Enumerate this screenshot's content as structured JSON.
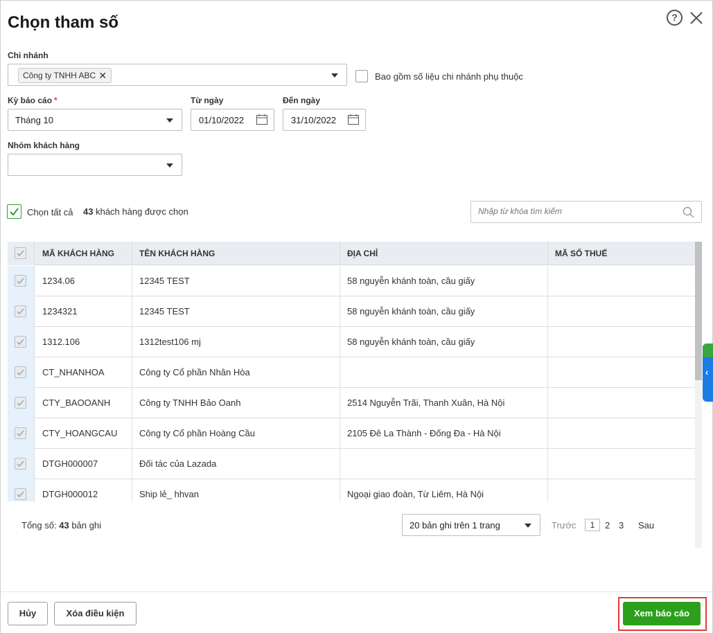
{
  "dialog": {
    "title": "Chọn tham số"
  },
  "branch": {
    "label": "Chi nhánh",
    "selected_chip": "Công ty TNHH ABC",
    "chip_remove": "✕",
    "include_dependent_label": "Bao gồm số liệu chi nhánh phụ thuộc"
  },
  "period": {
    "label": "Kỳ báo cáo",
    "required_mark": "*",
    "value": "Tháng 10"
  },
  "from_date": {
    "label": "Từ ngày",
    "value": "01/10/2022"
  },
  "to_date": {
    "label": "Đến ngày",
    "value": "31/10/2022"
  },
  "customer_group": {
    "label": "Nhóm khách hàng",
    "value": ""
  },
  "selection": {
    "select_all_label": "Chọn tất cả",
    "selected_count": "43",
    "selected_suffix": "khách hàng được chọn"
  },
  "search": {
    "placeholder": "Nhập từ khóa tìm kiếm"
  },
  "table": {
    "columns": [
      "MÃ KHÁCH HÀNG",
      "TÊN KHÁCH HÀNG",
      "ĐỊA CHỈ",
      "MÃ SỐ THUẾ"
    ],
    "rows": [
      [
        "1234.06",
        "12345 TEST",
        "58 nguyễn khánh toàn, cầu giấy",
        ""
      ],
      [
        "1234321",
        "12345 TEST",
        "58 nguyễn khánh toàn, cầu giấy",
        ""
      ],
      [
        "1312.106",
        "1312test106 mj",
        "58 nguyễn khánh toàn, cầu giấy",
        ""
      ],
      [
        "CT_NHANHOA",
        "Công ty Cổ phần Nhân Hòa",
        "",
        ""
      ],
      [
        "CTY_BAOOANH",
        "Công ty TNHH Bảo Oanh",
        "2514 Nguyễn Trãi, Thanh Xuân, Hà Nội",
        ""
      ],
      [
        "CTY_HOANGCAU",
        "Công ty Cổ phần Hoàng Cầu",
        "2105 Đê La Thành - Đống Đa - Hà Nội",
        ""
      ],
      [
        "DTGH000007",
        "Đối tác của Lazada",
        "",
        ""
      ],
      [
        "DTGH000012",
        "Ship lẻ_ hhvan",
        "Ngoại giao đoàn, Từ Liêm, Hà Nội",
        ""
      ]
    ]
  },
  "pager": {
    "total_prefix": "Tổng số:",
    "total_count": "43",
    "total_suffix": "bản ghi",
    "page_size": "20 bản ghi trên 1 trang",
    "prev": "Trước",
    "pages": [
      "1",
      "2",
      "3"
    ],
    "next": "Sau"
  },
  "buttons": {
    "cancel": "Hủy",
    "clear": "Xóa điều kiện",
    "view_report": "Xem báo cáo"
  },
  "icons": {
    "help": "question-circle-icon",
    "close": "close-icon",
    "calendar": "calendar-icon",
    "search": "search-icon",
    "checkmark": "check-icon",
    "side_chevron": "chevron-left-icon"
  },
  "colors": {
    "primary_button": "#2ca01c",
    "highlight_border": "#e53935",
    "side_tab": "#1b7ce4"
  }
}
